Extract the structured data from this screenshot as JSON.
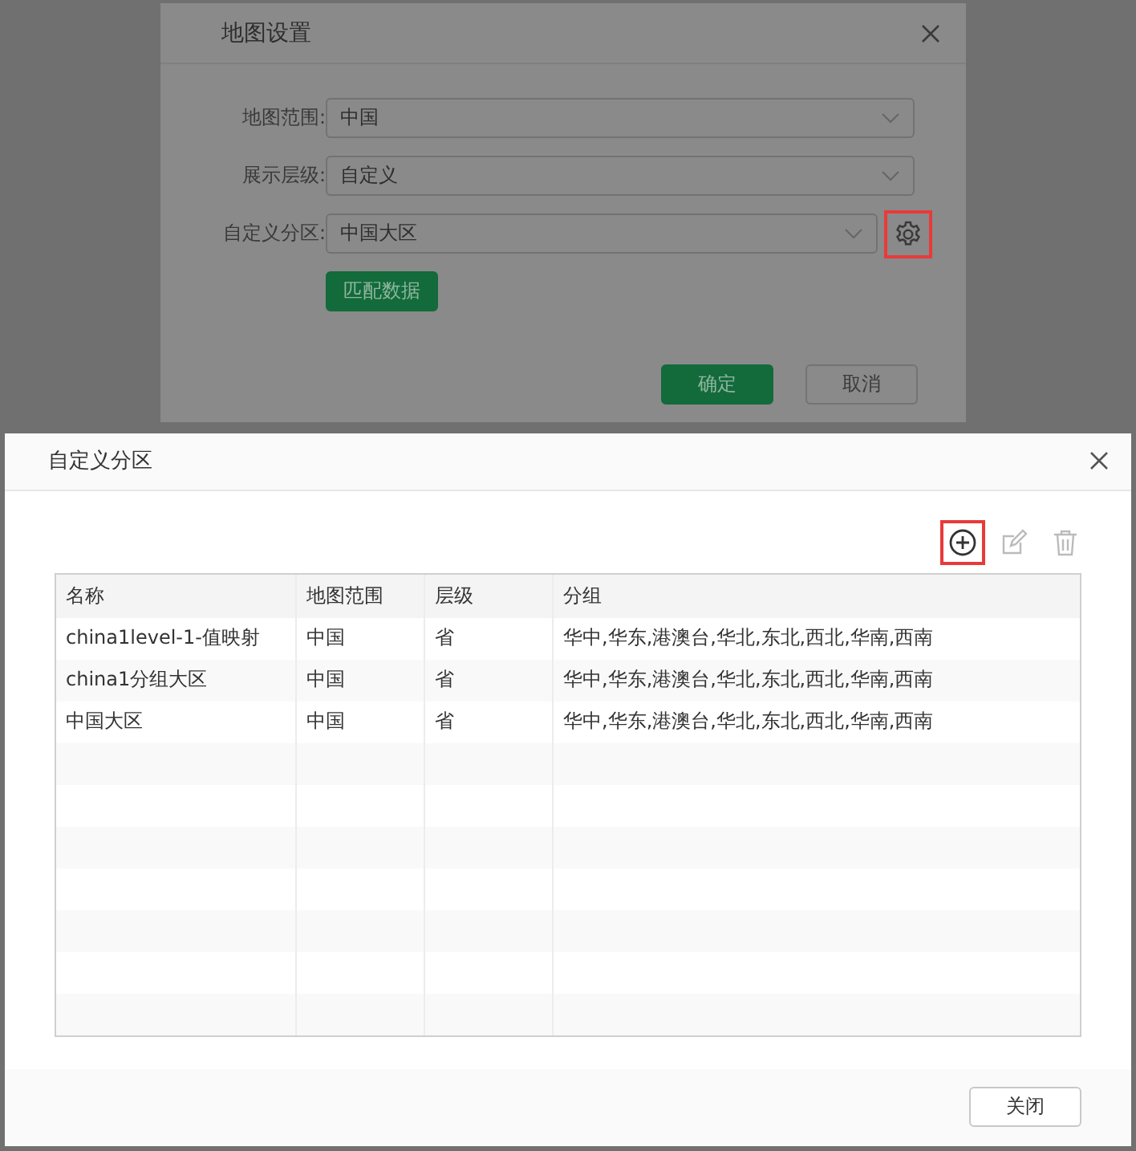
{
  "map_settings_dialog": {
    "title": "地图设置",
    "fields": [
      {
        "label": "地图范围:",
        "value": "中国"
      },
      {
        "label": "展示层级:",
        "value": "自定义"
      },
      {
        "label": "自定义分区:",
        "value": "中国大区",
        "settings_highlighted": true
      }
    ],
    "match_button": "匹配数据",
    "buttons": [
      {
        "label": "确定",
        "kind": "primary"
      },
      {
        "label": "取消",
        "kind": "default"
      }
    ]
  },
  "custom_partition_dialog": {
    "title": "自定义分区",
    "toolbar": [
      {
        "kind": "add",
        "highlighted": true,
        "disabled": false
      },
      {
        "kind": "edit",
        "highlighted": false,
        "disabled": true
      },
      {
        "kind": "delete",
        "highlighted": false,
        "disabled": true
      }
    ],
    "table": {
      "columns": [
        "名称",
        "地图范围",
        "层级",
        "分组"
      ],
      "rows": [
        [
          "china1level-1-值映射",
          "中国",
          "省",
          "华中,华东,港澳台,华北,东北,西北,华南,西南"
        ],
        [
          "china1分组大区",
          "中国",
          "省",
          "华中,华东,港澳台,华北,东北,西北,华南,西南"
        ],
        [
          "中国大区",
          "中国",
          "省",
          "华中,华东,港澳台,华北,东北,西北,华南,西南"
        ]
      ]
    },
    "close_button": "关闭"
  }
}
